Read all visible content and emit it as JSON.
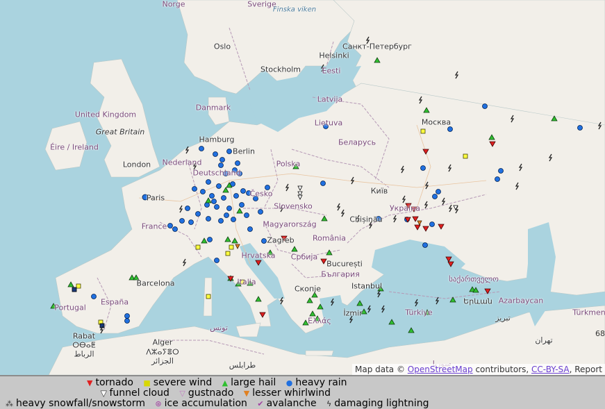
{
  "map": {
    "places": [
      {
        "name": "Sverige",
        "kind": "country"
      },
      {
        "name": "Norge",
        "kind": "country"
      },
      {
        "name": "Oslo",
        "kind": "city"
      },
      {
        "name": "Stockholm",
        "kind": "city"
      },
      {
        "name": "Helsinki",
        "kind": "city"
      },
      {
        "name": "Санкт-Петербург",
        "kind": "city"
      },
      {
        "name": "Eesti",
        "kind": "country"
      },
      {
        "name": "Latvija",
        "kind": "country"
      },
      {
        "name": "Lietuva",
        "kind": "country"
      },
      {
        "name": "Danmark",
        "kind": "country"
      },
      {
        "name": "United Kingdom",
        "kind": "country"
      },
      {
        "name": "Great Britain",
        "kind": "island"
      },
      {
        "name": "Éire / Ireland",
        "kind": "country"
      },
      {
        "name": "London",
        "kind": "city"
      },
      {
        "name": "Hamburg",
        "kind": "city"
      },
      {
        "name": "Berlin",
        "kind": "city"
      },
      {
        "name": "Nederland",
        "kind": "country"
      },
      {
        "name": "Deutschland",
        "kind": "country"
      },
      {
        "name": "Polska",
        "kind": "country"
      },
      {
        "name": "Беларусь",
        "kind": "country"
      },
      {
        "name": "Москва",
        "kind": "city"
      },
      {
        "name": "Paris",
        "kind": "city"
      },
      {
        "name": "France",
        "kind": "country"
      },
      {
        "name": "Česko",
        "kind": "country"
      },
      {
        "name": "Slovensko",
        "kind": "country"
      },
      {
        "name": "Київ",
        "kind": "city"
      },
      {
        "name": "Україна",
        "kind": "country"
      },
      {
        "name": "Magyarország",
        "kind": "country"
      },
      {
        "name": "Chișinău",
        "kind": "city"
      },
      {
        "name": "Zagreb",
        "kind": "city"
      },
      {
        "name": "Hrvatska",
        "kind": "country"
      },
      {
        "name": "România",
        "kind": "country"
      },
      {
        "name": "Србија",
        "kind": "country"
      },
      {
        "name": "București",
        "kind": "city"
      },
      {
        "name": "България",
        "kind": "country"
      },
      {
        "name": "Italia",
        "kind": "country"
      },
      {
        "name": "Скопје",
        "kind": "city"
      },
      {
        "name": "Istanbul",
        "kind": "city"
      },
      {
        "name": "Ελλάς",
        "kind": "country"
      },
      {
        "name": "İzmir",
        "kind": "city"
      },
      {
        "name": "Türkiye",
        "kind": "country"
      },
      {
        "name": "საქართველო",
        "kind": "country"
      },
      {
        "name": "Երևան",
        "kind": "city"
      },
      {
        "name": "Azarbaycan",
        "kind": "country"
      },
      {
        "name": "Türkmen",
        "kind": "country"
      },
      {
        "name": "Barcelona",
        "kind": "city"
      },
      {
        "name": "España",
        "kind": "country"
      },
      {
        "name": "Portugal",
        "kind": "country"
      },
      {
        "name": "Rabat",
        "kind": "city"
      },
      {
        "name": "ⵔⴱⴰⵟ",
        "kind": "city"
      },
      {
        "name": "الرباط",
        "kind": "city"
      },
      {
        "name": "Alger",
        "kind": "city"
      },
      {
        "name": "ⴷⵣⴰⵢⴻⵔ",
        "kind": "city"
      },
      {
        "name": "الجزائر",
        "kind": "city"
      },
      {
        "name": "تونس",
        "kind": "country"
      },
      {
        "name": "طرابلس",
        "kind": "city"
      },
      {
        "name": "سوريا",
        "kind": "country"
      },
      {
        "name": "تبريز",
        "kind": "city"
      },
      {
        "name": "تهران",
        "kind": "city"
      },
      {
        "name": "Finska viken",
        "kind": "sea"
      }
    ],
    "scale_fragment": "68"
  },
  "attribution": {
    "prefix": "Map data © ",
    "osm_link": "OpenStreetMap",
    "middle": " contributors, ",
    "license_link": "CC-BY-SA",
    "suffix": ", Report"
  },
  "legend": {
    "tornado": "tornado",
    "severe_wind": "severe wind",
    "large_hail": "large hail",
    "heavy_rain": "heavy rain",
    "funnel_cloud": "funnel cloud",
    "gustnado": "gustnado",
    "lesser_whirlwind": "lesser whirlwind",
    "heavy_snowfall": "heavy snowfall/snowstorm",
    "ice_accumulation": "ice accumulation",
    "avalanche": "avalanche",
    "damaging_lightning": "damaging lightning"
  },
  "colors": {
    "sea": "#aad3df",
    "land": "#f2efe9",
    "border": "#b598b5",
    "tornado": "#e02020",
    "severe_wind": "#ffff40",
    "large_hail": "#30c030",
    "heavy_rain": "#2070e0",
    "funnel_cloud": "#ffffff",
    "gustnado": "#c080c0",
    "lesser_whirlwind": "#e08020"
  }
}
